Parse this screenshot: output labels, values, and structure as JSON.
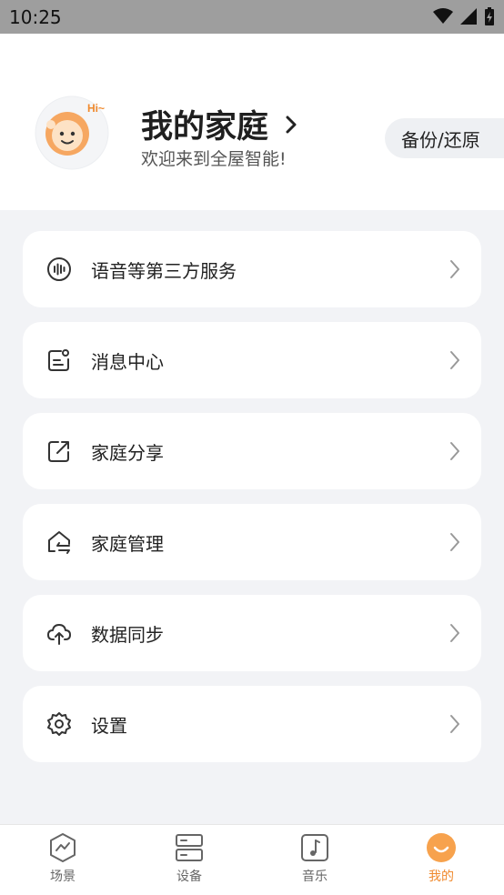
{
  "status_bar": {
    "time": "10:25"
  },
  "header": {
    "avatar_badge": "Hi~",
    "title": "我的家庭",
    "subtitle": "欢迎来到全屋智能!",
    "backup_label": "备份/还原"
  },
  "menu": [
    {
      "label": "语音等第三方服务",
      "icon": "voice-wave-icon"
    },
    {
      "label": "消息中心",
      "icon": "message-icon"
    },
    {
      "label": "家庭分享",
      "icon": "share-icon"
    },
    {
      "label": "家庭管理",
      "icon": "home-manage-icon"
    },
    {
      "label": "数据同步",
      "icon": "cloud-upload-icon"
    },
    {
      "label": "设置",
      "icon": "gear-icon"
    }
  ],
  "tabs": [
    {
      "label": "场景",
      "icon": "scene-icon",
      "active": false
    },
    {
      "label": "设备",
      "icon": "device-icon",
      "active": false
    },
    {
      "label": "音乐",
      "icon": "music-icon",
      "active": false
    },
    {
      "label": "我的",
      "icon": "smile-icon",
      "active": true
    }
  ],
  "colors": {
    "accent": "#f08a2e",
    "background": "#f2f3f6",
    "card": "#ffffff"
  }
}
